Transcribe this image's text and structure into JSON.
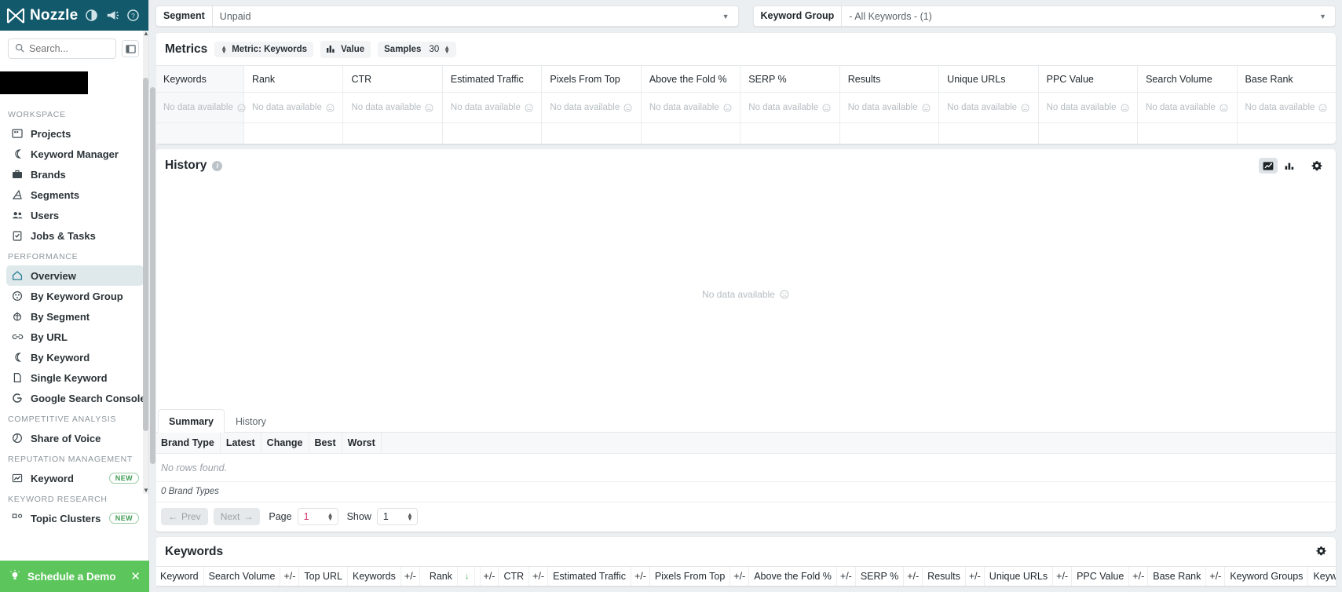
{
  "brand": {
    "name": "Nozzle",
    "logo_icon": "nozzle-logo-icon",
    "icons": [
      "contrast-icon",
      "megaphone-icon",
      "help-circle-icon"
    ]
  },
  "sidebar": {
    "search": {
      "placeholder": "Search...",
      "icon": "search-icon"
    },
    "collapse_icon": "panel-collapse-icon",
    "sections": [
      {
        "title": "WORKSPACE",
        "items": [
          {
            "label": "Projects",
            "icon": "projects-icon",
            "active": false
          },
          {
            "label": "Keyword Manager",
            "icon": "keyword-manager-icon",
            "active": false
          },
          {
            "label": "Brands",
            "icon": "briefcase-icon",
            "active": false
          },
          {
            "label": "Segments",
            "icon": "segments-icon",
            "active": false
          },
          {
            "label": "Users",
            "icon": "users-icon",
            "active": false
          },
          {
            "label": "Jobs & Tasks",
            "icon": "clipboard-check-icon",
            "active": false
          }
        ]
      },
      {
        "title": "PERFORMANCE",
        "items": [
          {
            "label": "Overview",
            "icon": "home-icon",
            "active": true
          },
          {
            "label": "By Keyword Group",
            "icon": "keyword-group-icon",
            "active": false
          },
          {
            "label": "By Segment",
            "icon": "segment-icon",
            "active": false
          },
          {
            "label": "By URL",
            "icon": "link-icon",
            "active": false
          },
          {
            "label": "By Keyword",
            "icon": "keyword-icon",
            "active": false
          },
          {
            "label": "Single Keyword",
            "icon": "file-icon",
            "active": false
          },
          {
            "label": "Google Search Console",
            "icon": "google-g-icon",
            "active": false
          }
        ]
      },
      {
        "title": "COMPETITIVE ANALYSIS",
        "items": [
          {
            "label": "Share of Voice",
            "icon": "pie-chart-icon",
            "active": false
          }
        ]
      },
      {
        "title": "REPUTATION MANAGEMENT",
        "items": [
          {
            "label": "Keyword",
            "icon": "chart-line-icon",
            "active": false,
            "badge": "NEW"
          }
        ]
      },
      {
        "title": "KEYWORD RESEARCH",
        "items": [
          {
            "label": "Topic Clusters",
            "icon": "cluster-icon",
            "active": false,
            "badge": "NEW"
          }
        ]
      }
    ],
    "demo_banner": {
      "label": "Schedule a Demo",
      "icon": "lightbulb-icon",
      "close_icon": "close-icon"
    }
  },
  "filters": {
    "segment": {
      "label": "Segment",
      "value": "Unpaid",
      "caret_icon": "chevron-down-icon"
    },
    "keyword_group": {
      "label": "Keyword Group",
      "value": "- All Keywords - (1)",
      "caret_icon": "chevron-down-icon"
    }
  },
  "metrics": {
    "title": "Metrics",
    "metric_chip": {
      "label": "Metric: Keywords",
      "icon": "sort-updown-icon"
    },
    "value_chip": {
      "label": "Value",
      "icon": "bar-chart-icon"
    },
    "samples": {
      "label": "Samples",
      "value": "30",
      "stepper_icon": "stepper-icon"
    },
    "columns": [
      "Keywords",
      "Rank",
      "CTR",
      "Estimated Traffic",
      "Pixels From Top",
      "Above the Fold %",
      "SERP %",
      "Results",
      "Unique URLs",
      "PPC Value",
      "Search Volume",
      "Base Rank"
    ],
    "empty_text": "No data available",
    "empty_icon": "sad-face-icon"
  },
  "history": {
    "title": "History",
    "info_icon": "info-icon",
    "view_icons": [
      {
        "name": "line-chart-icon",
        "active": true
      },
      {
        "name": "bar-chart-icon",
        "active": false
      },
      {
        "name": "gear-icon",
        "active": false
      }
    ],
    "empty_text": "No data available",
    "empty_icon": "sad-face-icon"
  },
  "summary": {
    "tabs": [
      {
        "label": "Summary",
        "active": true
      },
      {
        "label": "History",
        "active": false
      }
    ],
    "columns": [
      "Brand Type",
      "Latest",
      "Change",
      "Best",
      "Worst"
    ],
    "no_rows": "No rows found.",
    "count_text": "0 Brand Types",
    "pager": {
      "prev": "Prev",
      "prev_icon": "arrow-left-icon",
      "next": "Next",
      "next_icon": "arrow-right-icon",
      "page_label": "Page",
      "page_value": "1",
      "show_label": "Show",
      "show_value": "1"
    }
  },
  "keywords": {
    "title": "Keywords",
    "gear_icon": "gear-icon",
    "columns": [
      {
        "label": "Keyword"
      },
      {
        "label": "Search Volume"
      },
      {
        "label": "+/-",
        "pm": true
      },
      {
        "label": "Top URL"
      },
      {
        "label": "Keywords"
      },
      {
        "label": "+/-",
        "pm": true
      },
      {
        "label": "Rank",
        "sort": "desc",
        "sort_icon": "arrow-down-icon"
      },
      {
        "label": "+/-",
        "pm": true
      },
      {
        "label": "CTR"
      },
      {
        "label": "+/-",
        "pm": true
      },
      {
        "label": "Estimated Traffic"
      },
      {
        "label": "+/-",
        "pm": true
      },
      {
        "label": "Pixels From Top"
      },
      {
        "label": "+/-",
        "pm": true
      },
      {
        "label": "Above the Fold %"
      },
      {
        "label": "+/-",
        "pm": true
      },
      {
        "label": "SERP %"
      },
      {
        "label": "+/-",
        "pm": true
      },
      {
        "label": "Results"
      },
      {
        "label": "+/-",
        "pm": true
      },
      {
        "label": "Unique URLs"
      },
      {
        "label": "+/-",
        "pm": true
      },
      {
        "label": "PPC Value"
      },
      {
        "label": "+/-",
        "pm": true
      },
      {
        "label": "Base Rank"
      },
      {
        "label": "+/-",
        "pm": true
      },
      {
        "label": "Keyword Groups"
      },
      {
        "label": "Keyword ID"
      }
    ]
  },
  "colors": {
    "brand_teal": "#12596b",
    "accent_green": "#5cc65c",
    "active_nav": "#dfe9ec",
    "pink": "#d6336c"
  }
}
